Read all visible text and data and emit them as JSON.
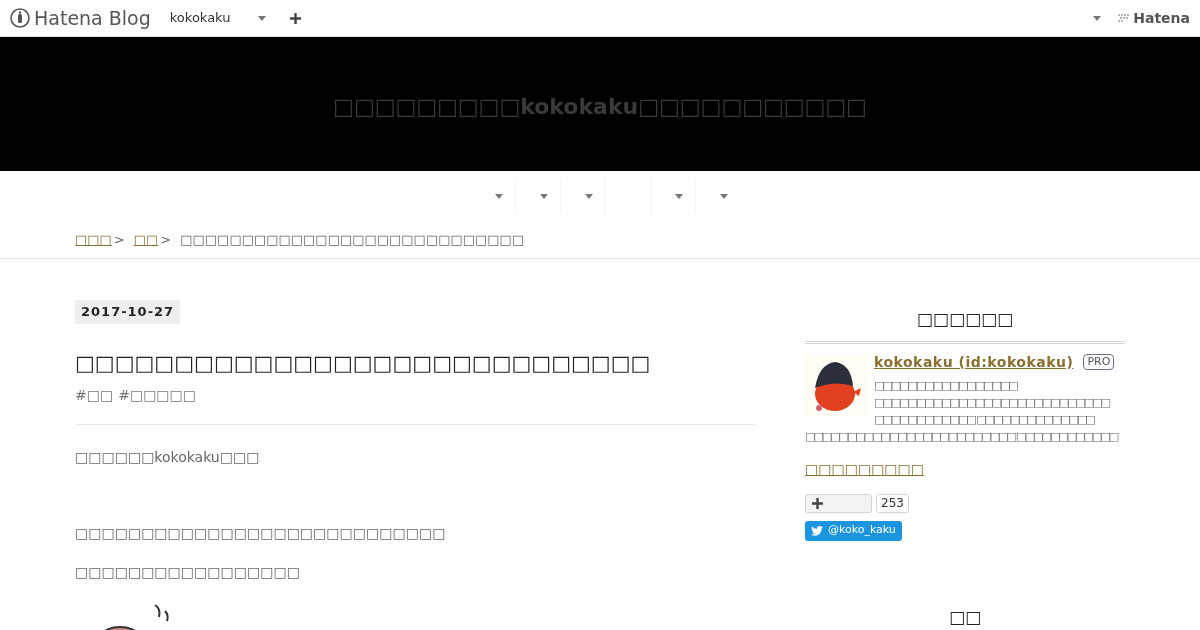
{
  "topbar": {
    "logo": "Hatena Blog",
    "blog_name": "kokokaku",
    "right_logo": "Hatena"
  },
  "header": {
    "title": "□□□□□□□□□kokokaku□□□□□□□□□□□"
  },
  "nav": {
    "items": [
      {
        "kind": "dropdown"
      },
      {
        "kind": "dropdown"
      },
      {
        "kind": "dropdown"
      },
      {
        "kind": "plain"
      },
      {
        "kind": "dropdown"
      },
      {
        "kind": "dropdown"
      }
    ]
  },
  "breadcrumb": [
    {
      "label": "□□□",
      "link": true,
      "separator": ">"
    },
    {
      "label": "□□",
      "link": true,
      "separator": ">"
    },
    {
      "label": "□□□□□□□□□□□□□□□□□□□□□□□□□□□□",
      "link": false
    }
  ],
  "article": {
    "date": "2017-10-27",
    "title": "□□□□□□□□□□□□□□□□□□□□□□□□□□□□□",
    "tags": [
      "#□□",
      "#□□□□□"
    ],
    "paragraphs": [
      "□□□□□□kokokaku□□□",
      "□□□□□□□□□□□□□□□□□□□□□□□□□□□□",
      "□□□□□□□□□□□□□□□□□"
    ],
    "image": {
      "kind": "picture"
    }
  },
  "sidebar": {
    "profile": {
      "heading": "□□□□□□",
      "name": "kokokaku (id:kokokaku)",
      "badge": "PRO",
      "description_lines": [
        "□□□□□□□□□□□□□□□□□",
        "□□□□□□□□□□□□□□□□□□□□□□□□□□□□",
        "□□□□□□□□□□□□ □□□□□□□□□□□□□□",
        "□□□□□□□□□□□□□□□□□□□□□□□□□ □□□□□□□□□□□□"
      ],
      "link": "□□□□□□□□□",
      "bookmark_count": "253",
      "twitter": "@koko_kaku"
    },
    "next_heading": "□□"
  }
}
